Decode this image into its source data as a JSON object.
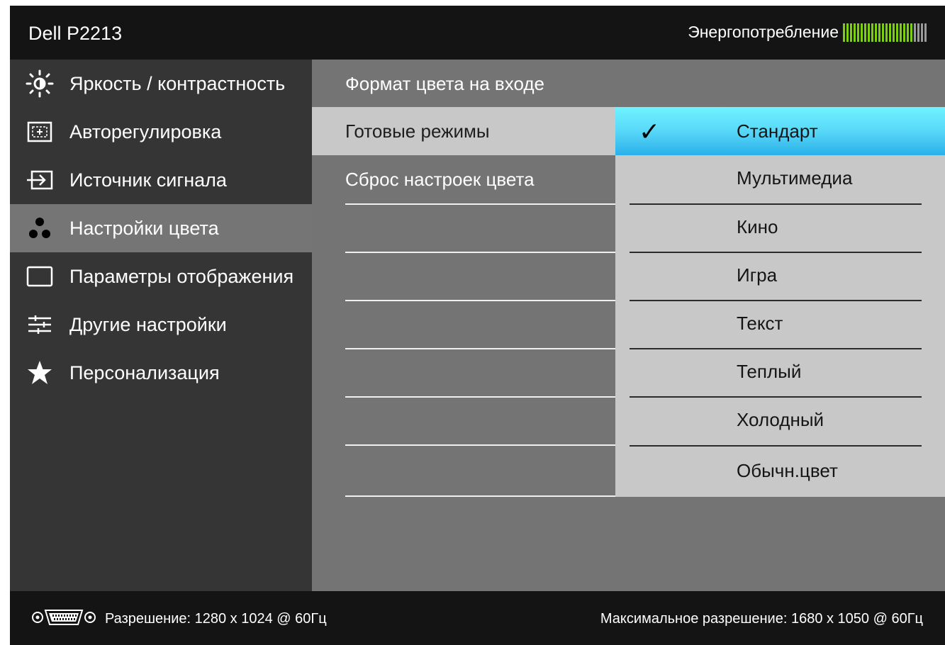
{
  "header": {
    "model": "Dell P2213",
    "energy_label": "Энергопотребление",
    "energy_level": 0.83,
    "energy_bar_color": "#7ccf10"
  },
  "sidebar": {
    "items": [
      {
        "label": "Яркость / контрастность",
        "icon": "brightness-icon",
        "active": false
      },
      {
        "label": "Авторегулировка",
        "icon": "auto-adjust-icon",
        "active": false
      },
      {
        "label": "Источник сигнала",
        "icon": "input-source-icon",
        "active": false
      },
      {
        "label": "Настройки цвета",
        "icon": "color-settings-icon",
        "active": true
      },
      {
        "label": "Параметры отображения",
        "icon": "display-settings-icon",
        "active": false
      },
      {
        "label": "Другие настройки",
        "icon": "other-settings-icon",
        "active": false
      },
      {
        "label": "Персонализация",
        "icon": "star-icon",
        "active": false
      }
    ]
  },
  "submenu": {
    "items": [
      {
        "label": "Формат цвета на входе",
        "selected": false
      },
      {
        "label": "Готовые режимы",
        "selected": true
      },
      {
        "label": "Сброс настроек цвета",
        "selected": false
      }
    ]
  },
  "preset_modes": {
    "selected_index": 0,
    "check_symbol": "✓",
    "highlight_color": "#58d8f8",
    "options": [
      "Стандарт",
      "Мультимедиа",
      "Кино",
      "Игра",
      "Текст",
      "Теплый",
      "Холодный",
      "Обычн.цвет"
    ]
  },
  "footer": {
    "connector_icon": "vga-connector-icon",
    "resolution": "Разрешение: 1280 x 1024 @ 60Гц",
    "max_resolution": "Максимальное разрешение: 1680 x 1050 @ 60Гц"
  }
}
